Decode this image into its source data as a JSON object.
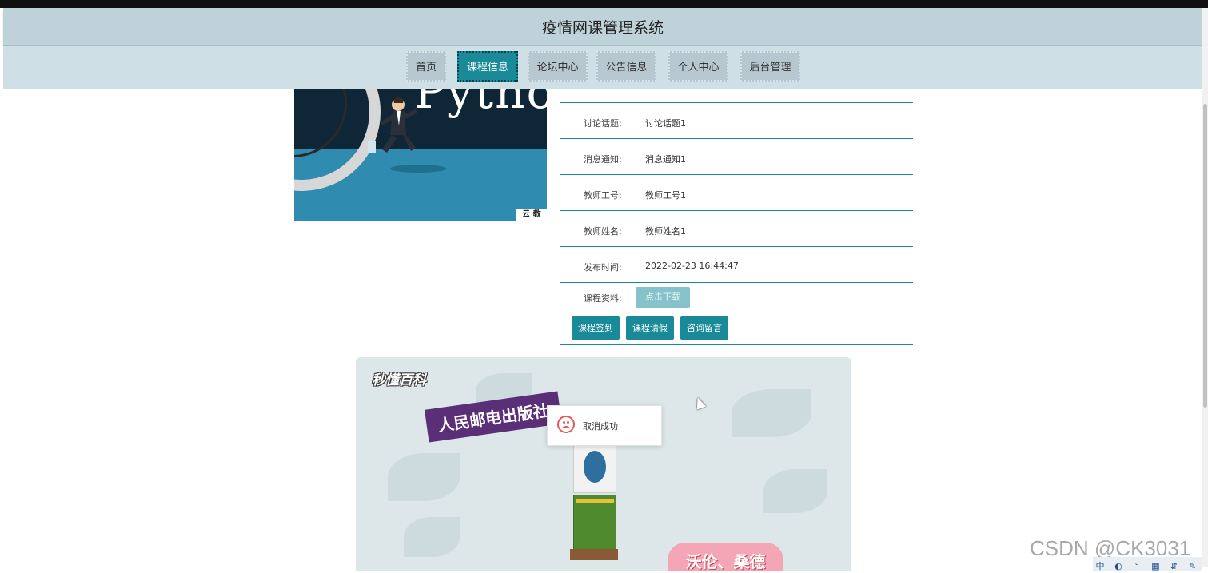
{
  "header": {
    "title": "疫情网课管理系统"
  },
  "nav": [
    {
      "label": "首页"
    },
    {
      "label": "课程信息"
    },
    {
      "label": "论坛中心"
    },
    {
      "label": "公告信息"
    },
    {
      "label": "个人中心"
    },
    {
      "label": "后台管理"
    }
  ],
  "colors": {
    "accent": "#1a8a98",
    "header_bg": "#bfd1d9",
    "nav_bg": "#cfdfe6"
  },
  "course_image": {
    "overlay_text": "Pytho",
    "corner_text": "云 教"
  },
  "detail": {
    "rows": [
      {
        "label": "讨论话题:",
        "value": "讨论话题1"
      },
      {
        "label": "消息通知:",
        "value": "消息通知1"
      },
      {
        "label": "教师工号:",
        "value": "教师工号1"
      },
      {
        "label": "教师姓名:",
        "value": "教师姓名1"
      },
      {
        "label": "发布时间:",
        "value": "2022-02-23 16:44:47"
      }
    ],
    "file_label": "课程资料:",
    "download_label": "点击下载",
    "actions": [
      "课程签到",
      "课程请假",
      "咨询留言"
    ]
  },
  "video": {
    "logo": "秒懂百科",
    "banner": "人民邮电出版社",
    "pink_text": "沃伦、桑德"
  },
  "toast": {
    "icon": "sad-face-icon",
    "message": "取消成功"
  },
  "watermark": "CSDN @CK3031",
  "tray": [
    "中",
    "◐",
    "°",
    "▦",
    "⇵",
    "✎"
  ]
}
